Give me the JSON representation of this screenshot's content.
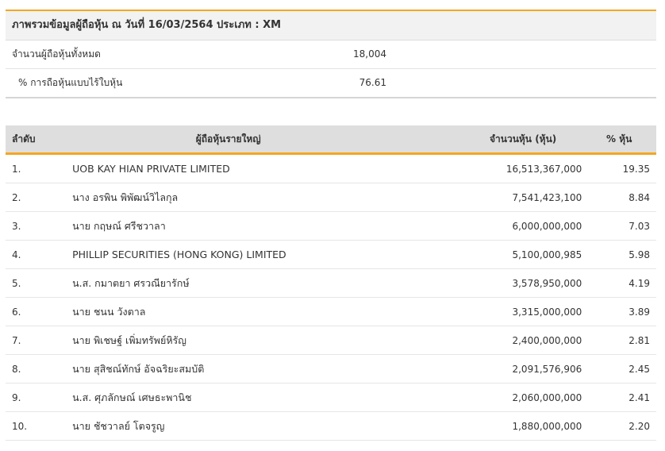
{
  "summary": {
    "title": "ภาพรวมข้อมูลผู้ถือหุ้น ณ วันที่ 16/03/2564 ประเภท : XM",
    "rows": [
      {
        "label": "จำนวนผู้ถือหุ้นทั้งหมด",
        "value": "18,004"
      },
      {
        "label": "% การถือหุ้นแบบไร้ใบหุ้น",
        "value": "76.61"
      }
    ]
  },
  "holders": {
    "headers": {
      "rank": "ลำดับ",
      "name": "ผู้ถือหุ้นรายใหญ่",
      "shares": "จำนวนหุ้น (หุ้น)",
      "pct": "% หุ้น"
    },
    "rows": [
      {
        "rank": "1.",
        "name": "UOB KAY HIAN PRIVATE LIMITED",
        "shares": "16,513,367,000",
        "pct": "19.35"
      },
      {
        "rank": "2.",
        "name": "นาง อรพิน พิพัฒน์วิไลกุล",
        "shares": "7,541,423,100",
        "pct": "8.84"
      },
      {
        "rank": "3.",
        "name": "นาย กฤษณ์ ศรีชวาลา",
        "shares": "6,000,000,000",
        "pct": "7.03"
      },
      {
        "rank": "4.",
        "name": "PHILLIP SECURITIES (HONG KONG) LIMITED",
        "shares": "5,100,000,985",
        "pct": "5.98"
      },
      {
        "rank": "5.",
        "name": "น.ส. กมาตยา ศรวณียารักษ์",
        "shares": "3,578,950,000",
        "pct": "4.19"
      },
      {
        "rank": "6.",
        "name": "นาย ชนน วังตาล",
        "shares": "3,315,000,000",
        "pct": "3.89"
      },
      {
        "rank": "7.",
        "name": "นาย พิเชษฐ์ เพิ่มทรัพย์หิรัญ",
        "shares": "2,400,000,000",
        "pct": "2.81"
      },
      {
        "rank": "8.",
        "name": "นาย สุสิชณ์ทักษ์ อัจฉริยะสมบัติ",
        "shares": "2,091,576,906",
        "pct": "2.45"
      },
      {
        "rank": "9.",
        "name": "น.ส. ศุภลักษณ์ เศษธะพานิช",
        "shares": "2,060,000,000",
        "pct": "2.41"
      },
      {
        "rank": "10.",
        "name": "นาย ชัชวาลย์ โตจรูญ",
        "shares": "1,880,000,000",
        "pct": "2.20"
      }
    ]
  },
  "colors": {
    "accent": "#f5a623",
    "header_bg": "#dedede",
    "title_bg": "#f2f2f2"
  }
}
